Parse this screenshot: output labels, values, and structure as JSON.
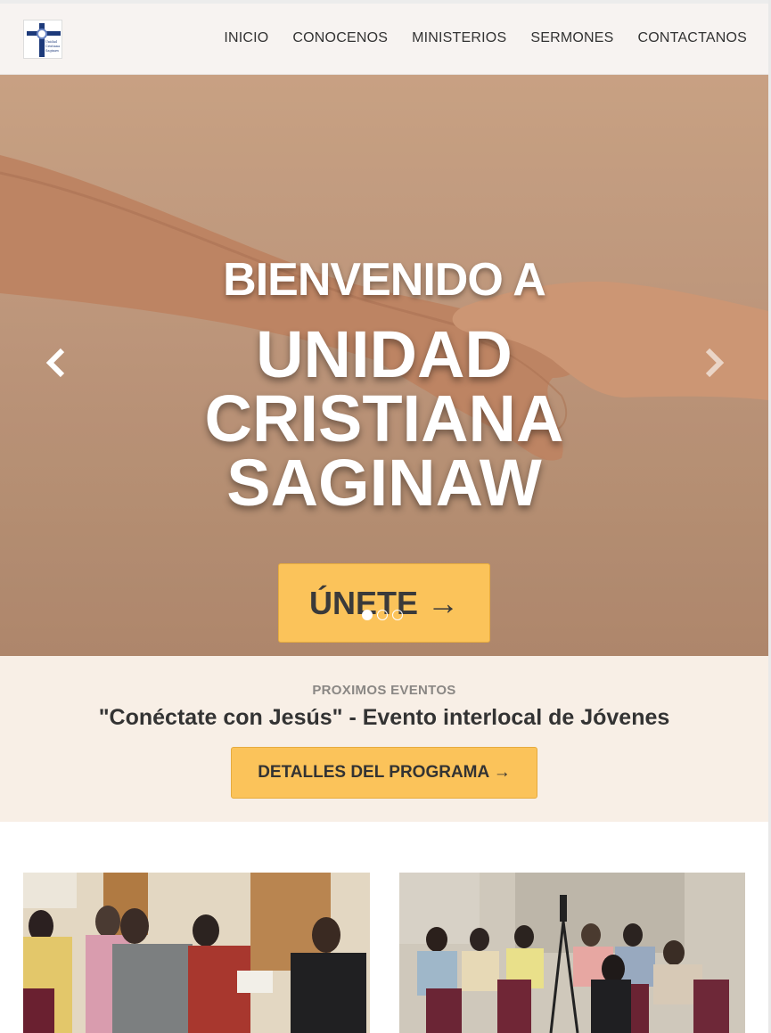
{
  "logo": {
    "alt": "Unidad Cristiana Saginaw",
    "text": "Unidad Cristiana Saginaw"
  },
  "nav": {
    "items": [
      "INICIO",
      "CONOCENOS",
      "MINISTERIOS",
      "SERMONES",
      "CONTACTANOS"
    ]
  },
  "hero": {
    "line1": "BIENVENIDO A",
    "line2a": "UNIDAD",
    "line2b": "CRISTIANA",
    "line2c": "SAGINAW",
    "button": "ÚNETE →",
    "prev_icon": "chevron-left-icon",
    "next_icon": "chevron-right-icon",
    "slides": 3,
    "active_slide": 1
  },
  "events": {
    "kicker": "PROXIMOS EVENTOS",
    "title": "\"Conéctate con Jesús\" - Evento interlocal de Jóvenes",
    "button": "DETALLES DEL PROGRAMA →"
  },
  "colors": {
    "accent": "#fbc35a",
    "navbar": "#f7f3f1",
    "events_bg": "#f8efe6",
    "logo_blue": "#1d3a7a"
  }
}
